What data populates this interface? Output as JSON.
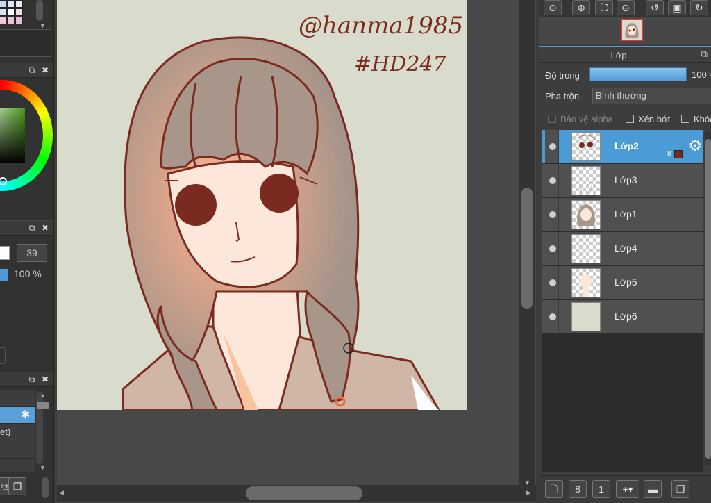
{
  "canvas": {
    "signature_line1": "@hanma1985",
    "signature_line2": "#HD247"
  },
  "left_panel": {
    "brush_size_value": "39",
    "opacity_value": "100 %",
    "list_item_label": "et)"
  },
  "layer_panel": {
    "title": "Lớp",
    "opacity_label": "Độ trong",
    "opacity_value": "100 %",
    "opacity_fraction": 1.0,
    "blend_label": "Pha trộn",
    "blend_value": "Bình thường",
    "protect_alpha_label": "Bảo vệ alpha",
    "clipping_label": "Xén bớt",
    "lock_label": "Khóa",
    "layers": [
      {
        "name": "Lớp2",
        "selected": true,
        "badge": "8"
      },
      {
        "name": "Lớp3",
        "selected": false
      },
      {
        "name": "Lớp1",
        "selected": false
      },
      {
        "name": "Lớp4",
        "selected": false
      },
      {
        "name": "Lớp5",
        "selected": false
      },
      {
        "name": "Lớp6",
        "selected": false
      }
    ]
  },
  "colors": {
    "accent": "#4b9bd6",
    "canvas_bg": "#d9dccc",
    "line_art": "#7a2a1f",
    "hair": "#a89484",
    "skin": "#fdeae0"
  },
  "icons": {
    "nav": [
      "zoom-actual-icon",
      "zoom-in-icon",
      "fit-icon",
      "zoom-out-icon",
      "rotate-left-icon",
      "fullscreen-icon",
      "rotate-right-icon"
    ],
    "layer_bottom": [
      "new-layer-icon",
      "new-8bit-layer-icon",
      "new-1bit-layer-icon",
      "add-layer-menu-icon",
      "new-folder-icon",
      "duplicate-icon"
    ]
  }
}
